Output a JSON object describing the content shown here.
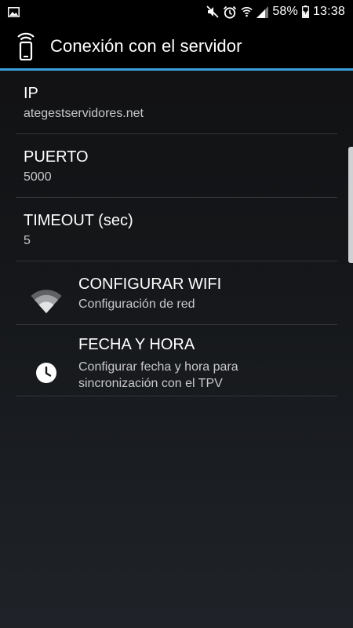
{
  "status_bar": {
    "left_icon": "image-icon",
    "icons": [
      "mute-icon",
      "alarm-icon",
      "wifi-icon",
      "signal-icon",
      "battery-charging-icon"
    ],
    "battery_percent": "58%",
    "time": "13:38"
  },
  "app_bar": {
    "icon": "phone-wireless-icon",
    "title": "Conexión con el servidor"
  },
  "settings": {
    "ip": {
      "title": "IP",
      "value": "ategestservidores.net"
    },
    "port": {
      "title": "PUERTO",
      "value": "5000"
    },
    "timeout": {
      "title": "TIMEOUT (sec)",
      "value": "5"
    },
    "wifi": {
      "icon": "wifi-icon",
      "title": "CONFIGURAR WIFI",
      "summary": "Configuración de red"
    },
    "datetime": {
      "icon": "clock-icon",
      "title": "FECHA Y HORA",
      "summary_line1": "Configurar fecha y hora para",
      "summary_line2": "sincronización con el TPV"
    }
  },
  "colors": {
    "accent": "#3da0dc",
    "background_top": "#101011",
    "background_bottom": "#1f2328"
  }
}
